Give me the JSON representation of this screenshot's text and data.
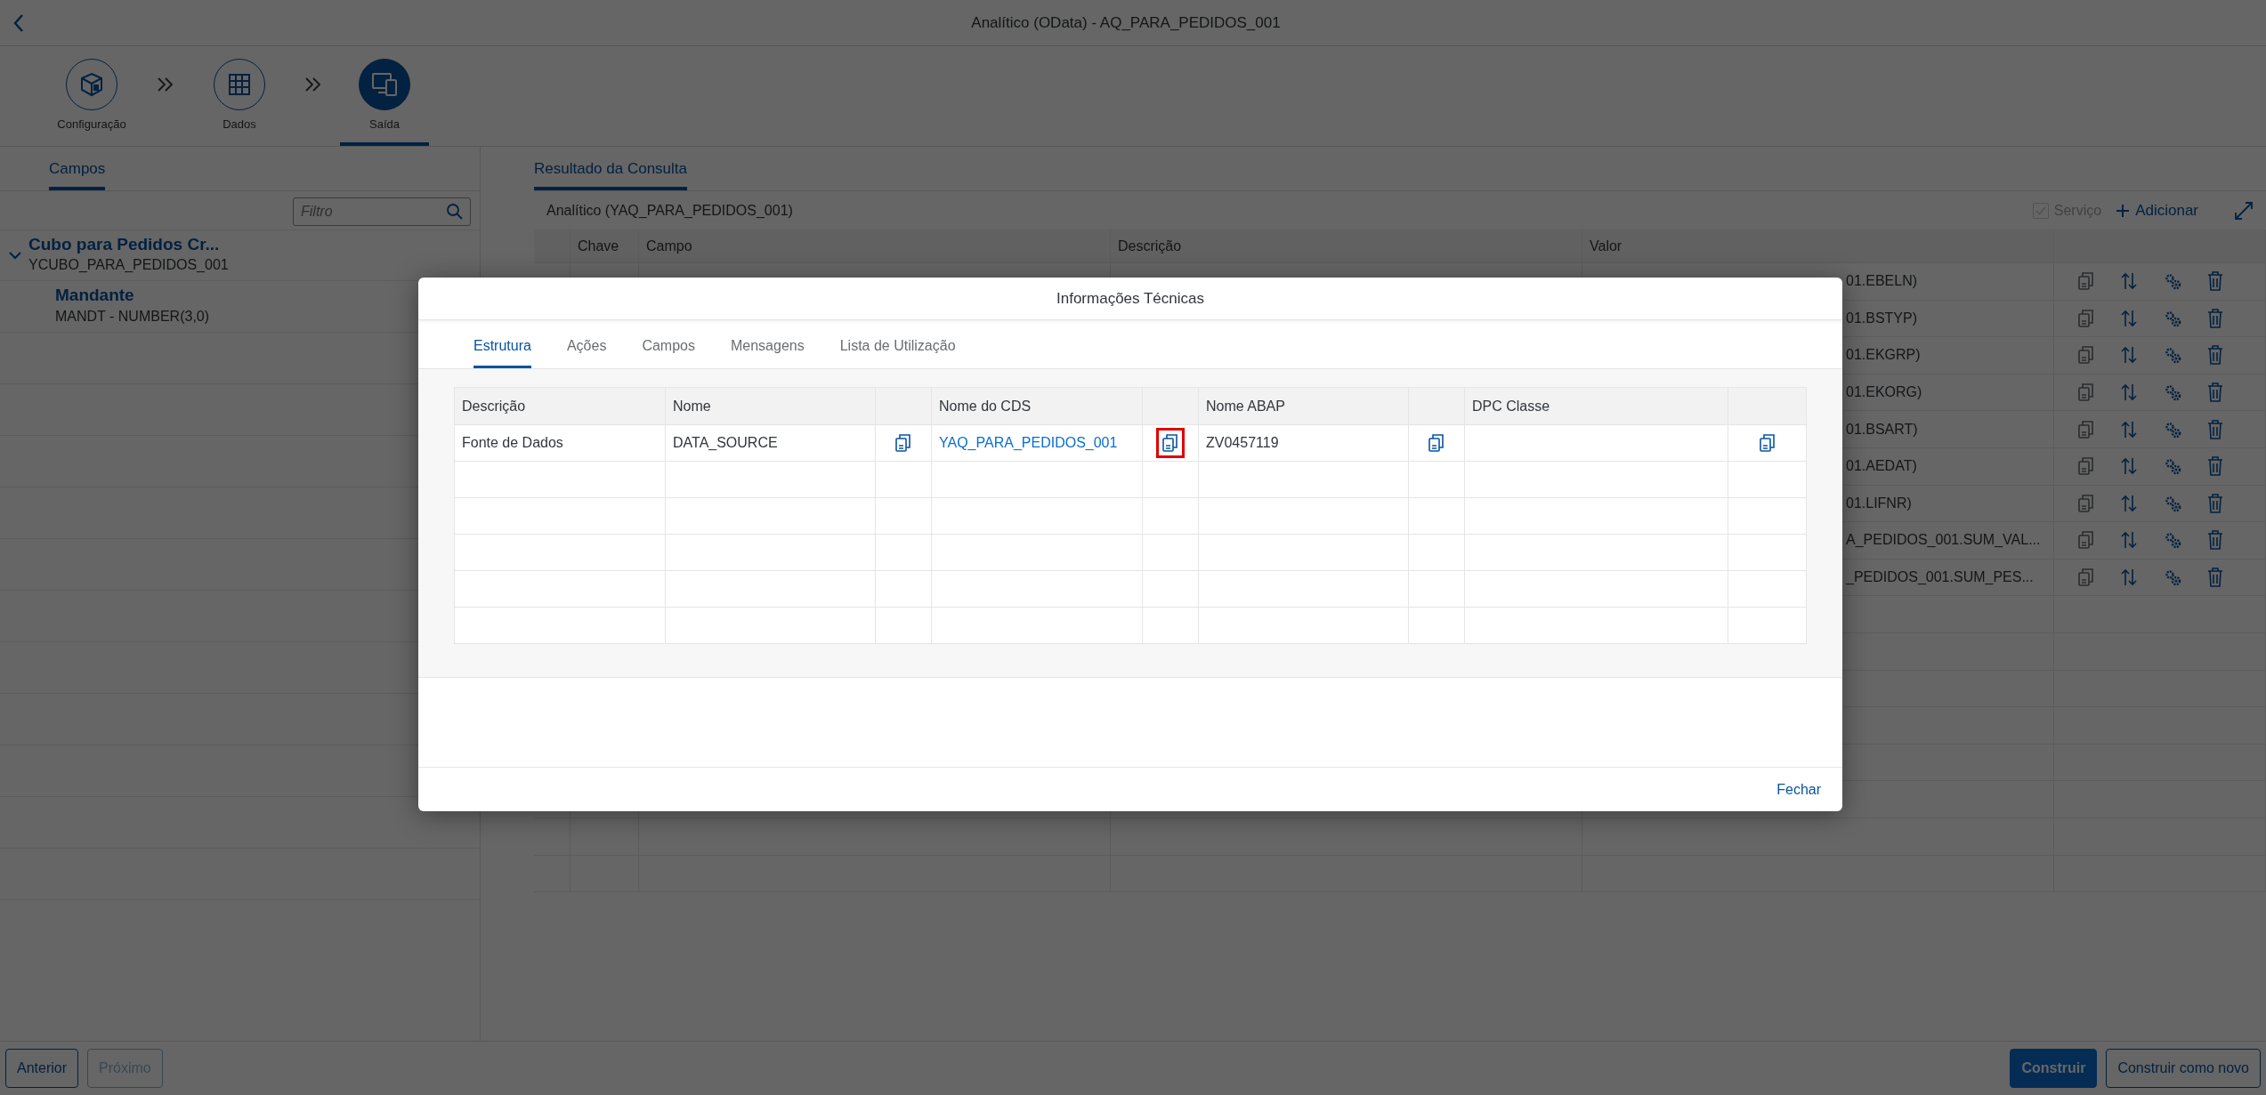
{
  "header": {
    "title": "Analítico (OData) - AQ_PARA_PEDIDOS_001"
  },
  "steps": [
    {
      "label": "Configuração",
      "kind": "cube",
      "selected": false
    },
    {
      "label": "Dados",
      "kind": "grid",
      "selected": false
    },
    {
      "label": "Saída",
      "kind": "devices",
      "selected": true
    }
  ],
  "left_panel": {
    "tabs": [
      {
        "label": "Campos",
        "selected": true
      }
    ],
    "filter": {
      "placeholder": "Filtro"
    },
    "tree": [
      {
        "title": "Cubo para Pedidos Cr...",
        "subtitle": "YCUBO_PARA_PEDIDOS_001",
        "expanded": true,
        "children": [
          {
            "title": "Mandante",
            "subtitle": "MANDT - NUMBER(3,0)"
          }
        ]
      }
    ]
  },
  "right_panel": {
    "tabs": [
      {
        "label": "Resultado da Consulta",
        "selected": true
      }
    ],
    "table_title": "Analítico (YAQ_PARA_PEDIDOS_001)",
    "service": {
      "label": "Serviço",
      "checked": true,
      "disabled": true
    },
    "add_button": "Adicionar",
    "columns": [
      "Chave",
      "Campo",
      "Descrição",
      "Valor"
    ],
    "rows": [
      {
        "valor": "01.EBELN)"
      },
      {
        "valor": "01.BSTYP)"
      },
      {
        "valor": "01.EKGRP)"
      },
      {
        "valor": "01.EKORG)"
      },
      {
        "valor": "01.BSART)"
      },
      {
        "valor": "01.AEDAT)"
      },
      {
        "valor": "01.LIFNR)"
      },
      {
        "valor": "A_PEDIDOS_001.SUM_VAL..."
      },
      {
        "valor": "_PEDIDOS_001.SUM_PES..."
      }
    ]
  },
  "dialog": {
    "title": "Informações Técnicas",
    "tabs": [
      {
        "label": "Estrutura",
        "selected": true
      },
      {
        "label": "Ações",
        "selected": false
      },
      {
        "label": "Campos",
        "selected": false
      },
      {
        "label": "Mensagens",
        "selected": false
      },
      {
        "label": "Lista de Utilização",
        "selected": false
      }
    ],
    "columns": [
      {
        "label": "Descrição",
        "copy_column": false
      },
      {
        "label": "Nome",
        "copy_column": true
      },
      {
        "label": "Nome do CDS",
        "copy_column": true
      },
      {
        "label": "Nome ABAP",
        "copy_column": true
      },
      {
        "label": "DPC Classe",
        "copy_column": true
      }
    ],
    "rows": [
      {
        "cells": [
          {
            "text": "Fonte de Dados"
          },
          {
            "text": "DATA_SOURCE",
            "copy": true
          },
          {
            "text": "YAQ_PARA_PEDIDOS_001",
            "kind": "link",
            "copy": true,
            "copy_highlighted": true
          },
          {
            "text": "ZV0457119",
            "copy": true
          },
          {
            "copy": true
          }
        ]
      }
    ],
    "close_button": "Fechar"
  },
  "footer": {
    "left_buttons": [
      {
        "label": "Anterior",
        "kind": "default",
        "disabled": false
      },
      {
        "label": "Próximo",
        "kind": "default",
        "disabled": true
      }
    ],
    "right_buttons": [
      {
        "label": "Construir",
        "kind": "primary",
        "disabled": false
      },
      {
        "label": "Construir como novo",
        "kind": "default",
        "disabled": false
      }
    ]
  }
}
